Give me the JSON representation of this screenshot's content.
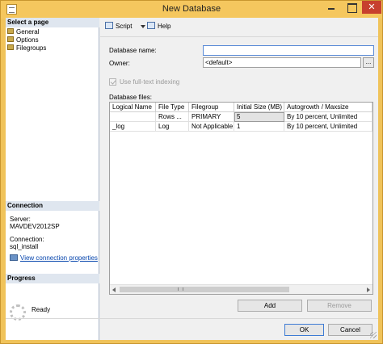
{
  "window": {
    "title": "New Database",
    "close_glyph": "✕"
  },
  "left_pane": {
    "select_page_title": "Select a page",
    "pages": [
      {
        "label": "General",
        "icon": "page-icon"
      },
      {
        "label": "Options",
        "icon": "page-icon"
      },
      {
        "label": "Filegroups",
        "icon": "page-icon"
      }
    ],
    "connection_title": "Connection",
    "server_label": "Server:",
    "server_value": "MAVDEV2012SP",
    "connection_label": "Connection:",
    "connection_value": "sql_install",
    "view_connection_link": "View connection properties",
    "progress_title": "Progress",
    "progress_status": "Ready"
  },
  "toolbar": {
    "script_label": "Script",
    "help_label": "Help"
  },
  "form": {
    "database_name_label": "Database name:",
    "database_name_value": "",
    "owner_label": "Owner:",
    "owner_value": "<default>",
    "ellipsis_label": "...",
    "fulltext_label": "Use full-text indexing",
    "fulltext_checked": true
  },
  "database_files": {
    "label": "Database files:",
    "columns": [
      "Logical Name",
      "File Type",
      "Filegroup",
      "Initial Size (MB)",
      "Autogrowth / Maxsize"
    ],
    "rows": [
      [
        "",
        "Rows ...",
        "PRIMARY",
        "5",
        "By 10 percent, Unlimited"
      ],
      [
        "_log",
        "Log",
        "Not Applicable",
        "1",
        "By 10 percent, Unlimited"
      ]
    ]
  },
  "buttons": {
    "add": "Add",
    "remove": "Remove",
    "ok": "OK",
    "cancel": "Cancel"
  },
  "colors": {
    "title_bar": "#f5c75e",
    "close_button": "#c7402e",
    "link": "#0645ad"
  }
}
